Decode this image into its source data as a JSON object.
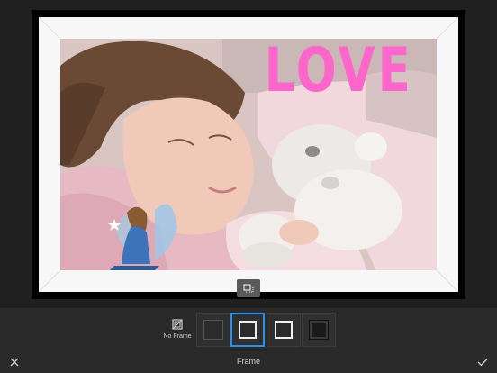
{
  "overlay": {
    "love_text": "LOVE"
  },
  "frame_picker": {
    "no_frame_label": "No Frame",
    "options": [
      {
        "name": "dark-gray"
      },
      {
        "name": "white-thin"
      },
      {
        "name": "white-bold"
      },
      {
        "name": "black"
      }
    ],
    "selected_index": 1
  },
  "bottom_bar": {
    "title": "Frame"
  },
  "colors": {
    "accent": "#2d8ef0",
    "love_pink": "#ff66cc",
    "toolbar_bg": "#2a2a2a"
  }
}
